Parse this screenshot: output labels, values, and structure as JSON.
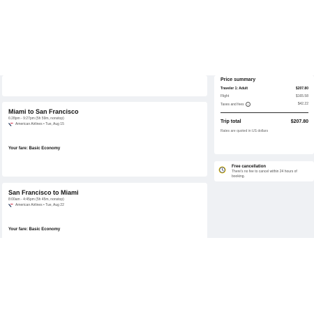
{
  "trips": [
    {
      "title": "Miami to San Francisco",
      "times": "6:28pm - 9:27pm (5h 59m, nonstop)",
      "airline": "American Airlines • Tue, Aug 15",
      "fare": "Your fare: Basic Economy"
    },
    {
      "title": "San Francisco to Miami",
      "times": "8:00am - 4:45pm (5h 45m, nonstop)",
      "airline": "American Airlines • Tue, Aug 22",
      "fare": "Your fare: Basic Economy"
    }
  ],
  "price_summary": {
    "title": "Price summary",
    "traveler_label": "Traveler 1: Adult",
    "traveler_amount": "$207.80",
    "flight_label": "Flight",
    "flight_amount": "$165.58",
    "taxes_label": "Taxes and fees",
    "taxes_amount": "$42.22",
    "total_label": "Trip total",
    "total_amount": "$207.80",
    "currency_note": "Rates are quoted in US dollars"
  },
  "free_cancellation": {
    "title": "Free cancellation",
    "text": "There's no fee to cancel within 24 hours of booking."
  },
  "colors": {
    "page_bg": "#eff1f4",
    "card_bg": "#ffffff",
    "cancel_icon_yellow": "#f7d117",
    "cancel_icon_navy": "#1f2f5e"
  },
  "icons": {
    "airline": "american-airlines-logo-icon",
    "info": "info-icon",
    "cancel": "clock-icon"
  }
}
